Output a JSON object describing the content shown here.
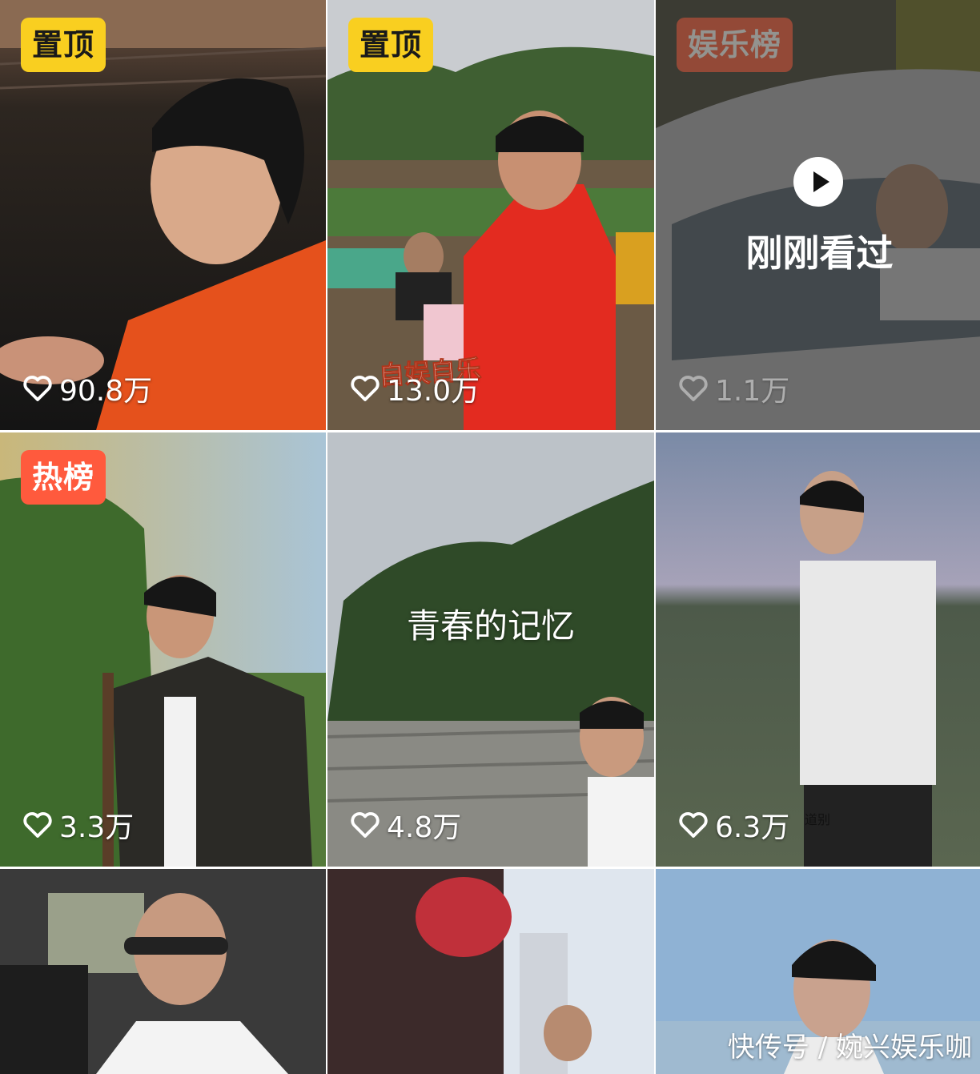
{
  "tiles": [
    {
      "badge": "置顶",
      "likes": "90.8万"
    },
    {
      "badge": "置顶",
      "likes": "13.0万",
      "sticker_text": "自娱自乐"
    },
    {
      "badge": "娱乐榜",
      "likes": "1.1万",
      "recent_label": "刚刚看过"
    },
    {
      "badge": "热榜",
      "likes": "3.3万"
    },
    {
      "likes": "4.8万",
      "caption": "青春的记忆"
    },
    {
      "likes": "6.3万",
      "caption": "道别"
    },
    {},
    {},
    {}
  ],
  "watermark": "快传号 / 婉兴娱乐咖",
  "icons": {
    "like": "heart-outline-icon",
    "play": "play-icon"
  },
  "colors": {
    "badge_yellow": "#f9cf20",
    "badge_red": "#ff5a3d"
  }
}
